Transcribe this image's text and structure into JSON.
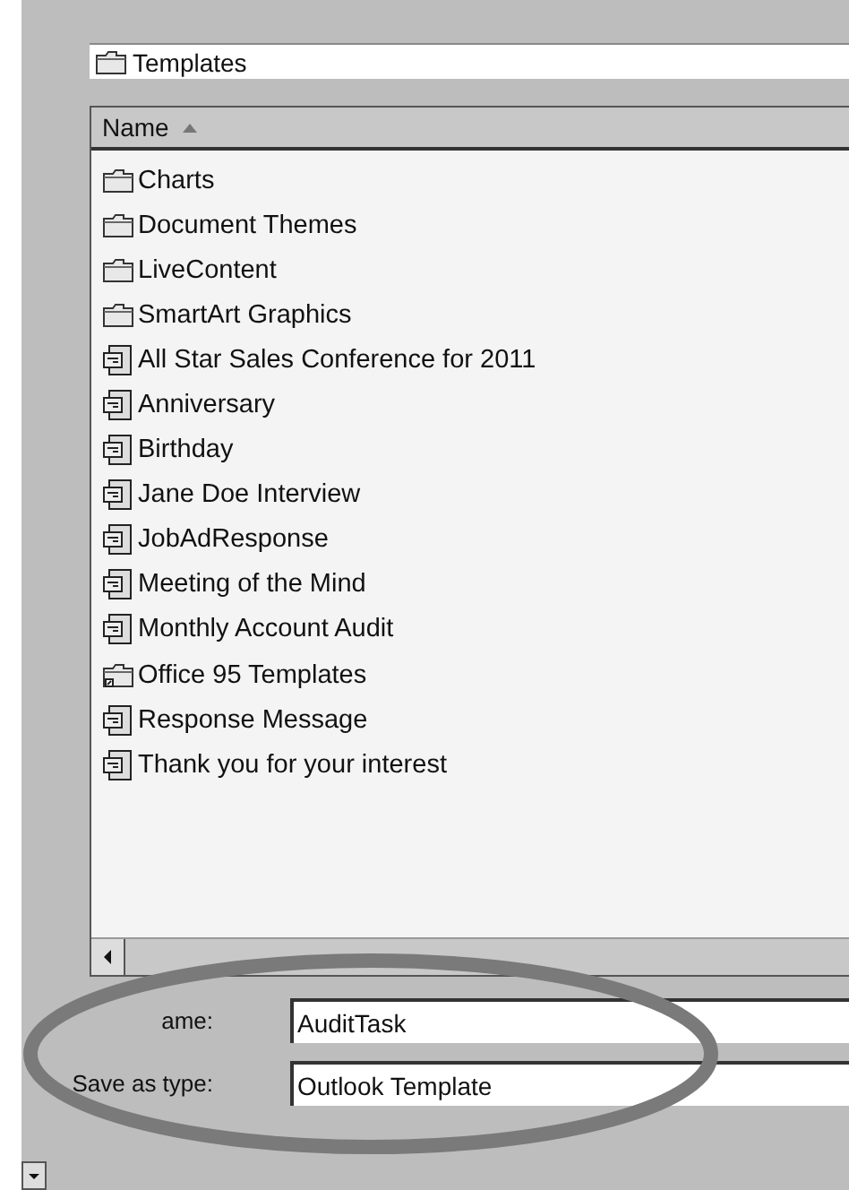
{
  "path_field": {
    "value": "Templates"
  },
  "list": {
    "column": "Name",
    "sort_ascending": true,
    "items": [
      {
        "kind": "folder",
        "name": "Charts"
      },
      {
        "kind": "folder",
        "name": "Document Themes"
      },
      {
        "kind": "folder",
        "name": "LiveContent"
      },
      {
        "kind": "folder",
        "name": "SmartArt Graphics"
      },
      {
        "kind": "template",
        "name": "All Star Sales Conference for 2011"
      },
      {
        "kind": "template",
        "name": "Anniversary"
      },
      {
        "kind": "template",
        "name": "Birthday"
      },
      {
        "kind": "template",
        "name": "Jane Doe Interview"
      },
      {
        "kind": "template",
        "name": "JobAdResponse"
      },
      {
        "kind": "template",
        "name": "Meeting of the Mind"
      },
      {
        "kind": "template",
        "name": "Monthly Account Audit"
      },
      {
        "kind": "shortcut-folder",
        "name": "Office 95 Templates"
      },
      {
        "kind": "template",
        "name": "Response Message"
      },
      {
        "kind": "template",
        "name": "Thank you for your interest"
      }
    ]
  },
  "file_name": {
    "label": "ame:",
    "value": "AuditTask"
  },
  "save_as_type": {
    "label": "Save as type:",
    "value": "Outlook Template"
  }
}
